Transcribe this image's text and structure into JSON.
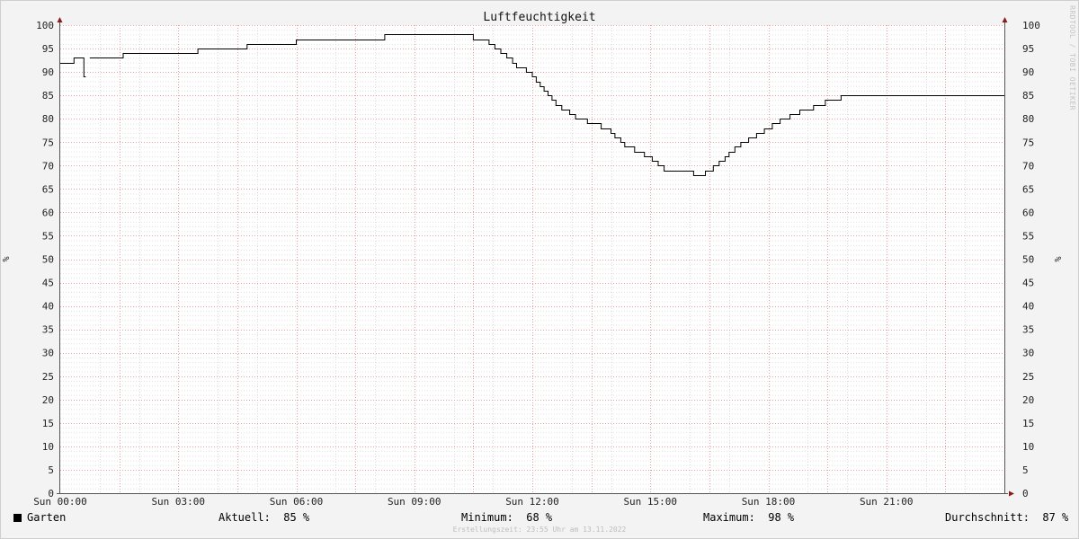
{
  "chart_data": {
    "type": "line",
    "title": "Luftfeuchtigkeit",
    "ylabel": "%",
    "ylim": [
      0,
      100
    ],
    "yticks": [
      0,
      5,
      10,
      15,
      20,
      25,
      30,
      35,
      40,
      45,
      50,
      55,
      60,
      65,
      70,
      75,
      80,
      85,
      90,
      95,
      100
    ],
    "xlim_hours": [
      0,
      24
    ],
    "x_tick_labels": [
      {
        "hour": 0,
        "label": "Sun 00:00"
      },
      {
        "hour": 3,
        "label": "Sun 03:00"
      },
      {
        "hour": 6,
        "label": "Sun 06:00"
      },
      {
        "hour": 9,
        "label": "Sun 09:00"
      },
      {
        "hour": 12,
        "label": "Sun 12:00"
      },
      {
        "hour": 15,
        "label": "Sun 15:00"
      },
      {
        "hour": 18,
        "label": "Sun 18:00"
      },
      {
        "hour": 21,
        "label": "Sun 21:00"
      }
    ],
    "grid": true,
    "series": [
      {
        "name": "Garten",
        "color": "#000000",
        "segments": [
          [
            [
              0,
              92
            ],
            [
              0.35,
              92
            ],
            [
              0.35,
              93
            ],
            [
              0.6,
              93
            ],
            [
              0.6,
              89
            ],
            [
              0.65,
              89
            ]
          ],
          [
            [
              0.75,
              93
            ],
            [
              1.6,
              93
            ],
            [
              1.6,
              94
            ],
            [
              3.5,
              94
            ],
            [
              3.5,
              95
            ],
            [
              4.75,
              95
            ],
            [
              4.75,
              96
            ],
            [
              6.0,
              96
            ],
            [
              6.0,
              97
            ],
            [
              8.25,
              97
            ],
            [
              8.25,
              98
            ],
            [
              10.5,
              98
            ],
            [
              10.5,
              97
            ],
            [
              10.9,
              97
            ],
            [
              10.9,
              96
            ],
            [
              11.05,
              96
            ],
            [
              11.05,
              95
            ],
            [
              11.2,
              95
            ],
            [
              11.2,
              94
            ],
            [
              11.35,
              94
            ],
            [
              11.35,
              93
            ],
            [
              11.5,
              93
            ],
            [
              11.5,
              92
            ],
            [
              11.6,
              92
            ],
            [
              11.6,
              91
            ],
            [
              11.85,
              91
            ],
            [
              11.85,
              90
            ],
            [
              12.0,
              90
            ],
            [
              12.0,
              89
            ],
            [
              12.1,
              89
            ],
            [
              12.1,
              88
            ],
            [
              12.2,
              88
            ],
            [
              12.2,
              87
            ],
            [
              12.3,
              87
            ],
            [
              12.3,
              86
            ],
            [
              12.4,
              86
            ],
            [
              12.4,
              85
            ],
            [
              12.5,
              85
            ],
            [
              12.5,
              84
            ],
            [
              12.6,
              84
            ],
            [
              12.6,
              83
            ],
            [
              12.75,
              83
            ],
            [
              12.75,
              82
            ],
            [
              12.95,
              82
            ],
            [
              12.95,
              81
            ],
            [
              13.1,
              81
            ],
            [
              13.1,
              80
            ],
            [
              13.4,
              80
            ],
            [
              13.4,
              79
            ],
            [
              13.75,
              79
            ],
            [
              13.75,
              78
            ],
            [
              14.0,
              78
            ],
            [
              14.0,
              77
            ],
            [
              14.1,
              77
            ],
            [
              14.1,
              76
            ],
            [
              14.25,
              76
            ],
            [
              14.25,
              75
            ],
            [
              14.35,
              75
            ],
            [
              14.35,
              74
            ],
            [
              14.6,
              74
            ],
            [
              14.6,
              73
            ],
            [
              14.85,
              73
            ],
            [
              14.85,
              72
            ],
            [
              15.05,
              72
            ],
            [
              15.05,
              71
            ],
            [
              15.2,
              71
            ],
            [
              15.2,
              70
            ],
            [
              15.35,
              70
            ],
            [
              15.35,
              69
            ],
            [
              16.1,
              69
            ],
            [
              16.1,
              68
            ],
            [
              16.4,
              68
            ],
            [
              16.4,
              69
            ],
            [
              16.6,
              69
            ],
            [
              16.6,
              70
            ],
            [
              16.75,
              70
            ],
            [
              16.75,
              71
            ],
            [
              16.9,
              71
            ],
            [
              16.9,
              72
            ],
            [
              17.0,
              72
            ],
            [
              17.0,
              73
            ],
            [
              17.15,
              73
            ],
            [
              17.15,
              74
            ],
            [
              17.3,
              74
            ],
            [
              17.3,
              75
            ],
            [
              17.5,
              75
            ],
            [
              17.5,
              76
            ],
            [
              17.7,
              76
            ],
            [
              17.7,
              77
            ],
            [
              17.9,
              77
            ],
            [
              17.9,
              78
            ],
            [
              18.1,
              78
            ],
            [
              18.1,
              79
            ],
            [
              18.3,
              79
            ],
            [
              18.3,
              80
            ],
            [
              18.55,
              80
            ],
            [
              18.55,
              81
            ],
            [
              18.8,
              81
            ],
            [
              18.8,
              82
            ],
            [
              19.15,
              82
            ],
            [
              19.15,
              83
            ],
            [
              19.45,
              83
            ],
            [
              19.45,
              84
            ],
            [
              19.85,
              84
            ],
            [
              19.85,
              85
            ],
            [
              24,
              85
            ]
          ]
        ]
      }
    ]
  },
  "legend": {
    "series_name": "Garten",
    "aktuell_label": "Aktuell:",
    "aktuell_value": "85 %",
    "minimum_label": "Minimum:",
    "minimum_value": "68 %",
    "maximum_label": "Maximum:",
    "maximum_value": "98 %",
    "durchschnitt_label": "Durchschnitt:",
    "durchschnitt_value": "87 %"
  },
  "footer": "Erstellungszeit: 23:55 Uhr am 13.11.2022",
  "watermark": "RRDTOOL / TOBI OETIKER"
}
